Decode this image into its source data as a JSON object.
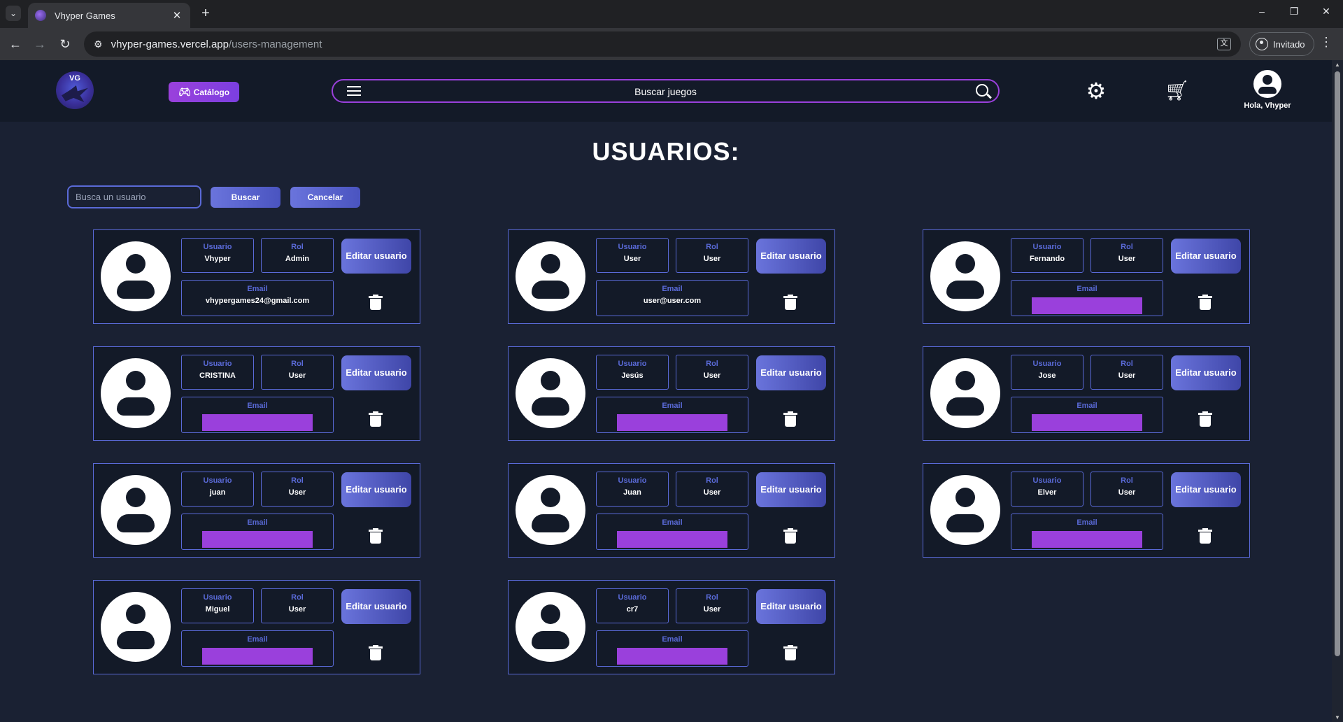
{
  "browser": {
    "tab_title": "Vhyper Games",
    "url_host": "vhyper-games.vercel.app",
    "url_path": "/users-management",
    "profile_label": "Invitado"
  },
  "header": {
    "logo_text": "VG",
    "catalog_label": "Catálogo",
    "search_placeholder": "Buscar juegos",
    "greeting": "Hola, Vhyper"
  },
  "main": {
    "title": "USUARIOS:",
    "search_placeholder": "Busca un usuario",
    "search_button": "Buscar",
    "cancel_button": "Cancelar"
  },
  "labels": {
    "usuario": "Usuario",
    "rol": "Rol",
    "email": "Email",
    "edit_button": "Editar usuario"
  },
  "users": [
    {
      "username": "Vhyper",
      "role": "Admin",
      "email": "vhypergames24@gmail.com"
    },
    {
      "username": "User",
      "role": "User",
      "email": "user@user.com"
    },
    {
      "username": "Fernando",
      "role": "User",
      "email": ""
    },
    {
      "username": "CRISTINA",
      "role": "User",
      "email": ""
    },
    {
      "username": "Jesús",
      "role": "User",
      "email": ""
    },
    {
      "username": "Jose",
      "role": "User",
      "email": ""
    },
    {
      "username": "juan",
      "role": "User",
      "email": ""
    },
    {
      "username": "Juan",
      "role": "User",
      "email": ""
    },
    {
      "username": "Elver",
      "role": "User",
      "email": ""
    },
    {
      "username": "Miguel",
      "role": "User",
      "email": ""
    },
    {
      "username": "cr7",
      "role": "User",
      "email": ""
    }
  ],
  "colors": {
    "background": "#1a2133",
    "card_border": "#5a6ad8",
    "accent_purple": "#9a40dc",
    "redaction": "#9a40dc"
  }
}
